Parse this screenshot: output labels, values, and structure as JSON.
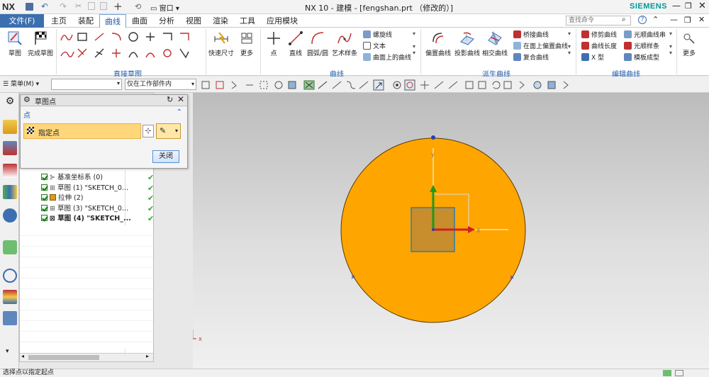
{
  "window": {
    "title": "NX 10 - 建模 - [fengshan.prt （修改的）]",
    "logo": "NX",
    "brand": "SIEMENS",
    "window_menu": "窗口",
    "search_placeholder": "查找命令"
  },
  "menu_tabs": [
    "文件(F)",
    "主页",
    "装配",
    "曲线",
    "曲面",
    "分析",
    "视图",
    "渲染",
    "工具",
    "应用模块"
  ],
  "active_tab": "曲线",
  "ribbon": {
    "groups": {
      "direct_sketch": "直接草图",
      "curve": "曲线",
      "derived_curve": "派生曲线",
      "edit_curve": "编辑曲线"
    },
    "sketch_button": "草图",
    "finish_sketch_button": "完成草图",
    "quick_dim": "快速尺寸",
    "more": "更多",
    "point": "点",
    "line": "直线",
    "arc": "圆弧/圆",
    "studio_spline": "艺术样条",
    "helix": "螺旋线",
    "text": "文本",
    "curve_on_surface": "曲面上的曲线",
    "offset_curve": "偏置曲线",
    "project_curve": "投影曲线",
    "intersect_curve": "相交曲线",
    "bridge_curve": "桥接曲线",
    "offset_on_face": "在面上偏置曲线",
    "composite_curve": "复合曲线",
    "trim_curve": "修剪曲线",
    "curve_length": "曲线长度",
    "x_form": "X 型",
    "smooth_curve_chain": "光顺曲线串",
    "smooth_spline": "光顺样条",
    "template_shape": "模板成型",
    "more2": "更多"
  },
  "toolbar2": {
    "menu_label": "菜单(M)",
    "filter_select": "",
    "scope_select": "仅在工作部件内"
  },
  "dialog": {
    "title": "草图点",
    "section": "点",
    "specify_point": "指定点",
    "close_button": "关闭"
  },
  "tree": {
    "items": [
      {
        "label": "基准坐标系 (0)",
        "bold": false
      },
      {
        "label": "草图 (1) \"SKETCH_0...",
        "bold": false
      },
      {
        "label": "拉伸 (2)",
        "bold": false
      },
      {
        "label": "草图 (3) \"SKETCH_0...",
        "bold": false
      },
      {
        "label": "草图 (4) \"SKETCH_...",
        "bold": true
      }
    ]
  },
  "status": {
    "prompt": "选择点以指定起点"
  },
  "colors": {
    "accent": "#1e5aa8",
    "model_fill": "#FFA500",
    "dialog_highlight": "#ffd77a",
    "title_bar": "#f3f3f3"
  }
}
